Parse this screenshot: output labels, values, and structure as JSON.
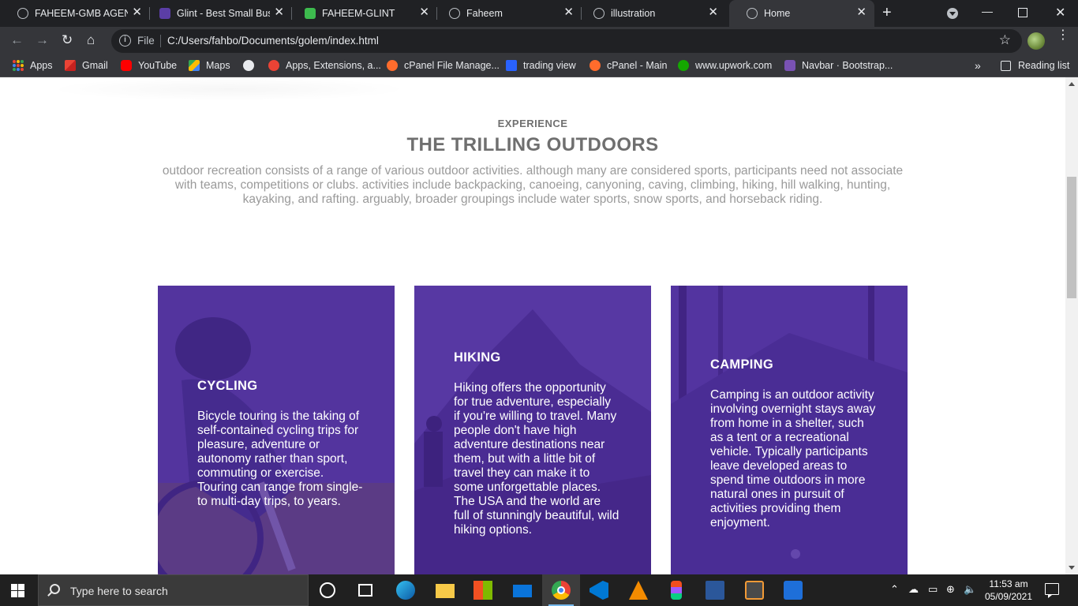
{
  "browser": {
    "tabs": [
      {
        "title": "FAHEEM-GMB AGENCY",
        "icon": "globe-icon"
      },
      {
        "title": "Glint - Best Small Business",
        "icon": "colorlib-icon"
      },
      {
        "title": "FAHEEM-GLINT",
        "icon": "g-icon"
      },
      {
        "title": "Faheem",
        "icon": "globe-icon"
      },
      {
        "title": "illustration",
        "icon": "globe-icon"
      },
      {
        "title": "Home",
        "icon": "globe-icon",
        "active": true
      }
    ],
    "address": {
      "scheme_label": "File",
      "url": "C:/Users/fahbo/Documents/golem/index.html"
    },
    "bookmarks": [
      {
        "label": "Apps",
        "icon": "apps-grid-icon"
      },
      {
        "label": "Gmail",
        "icon": "gmail-icon"
      },
      {
        "label": "YouTube",
        "icon": "youtube-icon"
      },
      {
        "label": "Maps",
        "icon": "maps-icon"
      },
      {
        "label": "",
        "icon": "globe-icon"
      },
      {
        "label": "Apps, Extensions, a...",
        "icon": "extensions-icon"
      },
      {
        "label": "cPanel File Manage...",
        "icon": "cpanel-icon"
      },
      {
        "label": "trading view",
        "icon": "tradingview-icon"
      },
      {
        "label": "cPanel - Main",
        "icon": "cpanel-icon"
      },
      {
        "label": "www.upwork.com",
        "icon": "upwork-icon"
      },
      {
        "label": "Navbar · Bootstrap...",
        "icon": "bootstrap-icon"
      }
    ],
    "reading_list_label": "Reading list",
    "overflow_label": "»"
  },
  "page": {
    "eyebrow": "EXPERIENCE",
    "heading": "THE TRILLING OUTDOORS",
    "intro": "outdoor recreation consists of a range of various outdoor activities. although many are considered sports, participants need not associate with teams, competitions or clubs. activities include backpacking, canoeing, canyoning, caving, climbing, hiking, hill walking, hunting, kayaking, and rafting. arguably, broader groupings include water sports, snow sports, and horseback riding.",
    "cards": [
      {
        "title": "CYCLING",
        "text": "Bicycle touring is the taking of self-contained cycling trips for pleasure, adventure or autonomy rather than sport, commuting or exercise. Touring can range from single-to multi-day trips, to years."
      },
      {
        "title": "HIKING",
        "text": "Hiking offers the opportunity for true adventure, especially if you're willing to travel. Many people don't have high adventure destinations near them, but with a little bit of travel they can make it to some unforgettable places. The USA and the world are full of stunningly beautiful, wild hiking options."
      },
      {
        "title": "CAMPING",
        "text": "Camping is an outdoor activity involving overnight stays away from home in a shelter, such as a tent or a recreational vehicle. Typically participants leave developed areas to spend time outdoors in more natural ones in pursuit of activities providing them enjoyment."
      }
    ],
    "card_overlay_color": "#4a269c"
  },
  "taskbar": {
    "search_placeholder": "Type here to search",
    "time": "11:53 am",
    "date": "05/09/2021",
    "pinned": [
      "cortana-icon",
      "task-view-icon",
      "edge-icon",
      "file-explorer-icon",
      "store-icon",
      "mail-icon",
      "chrome-icon",
      "vscode-icon",
      "vlc-icon",
      "figma-icon",
      "word-icon",
      "sublime-icon",
      "app-icon"
    ]
  }
}
